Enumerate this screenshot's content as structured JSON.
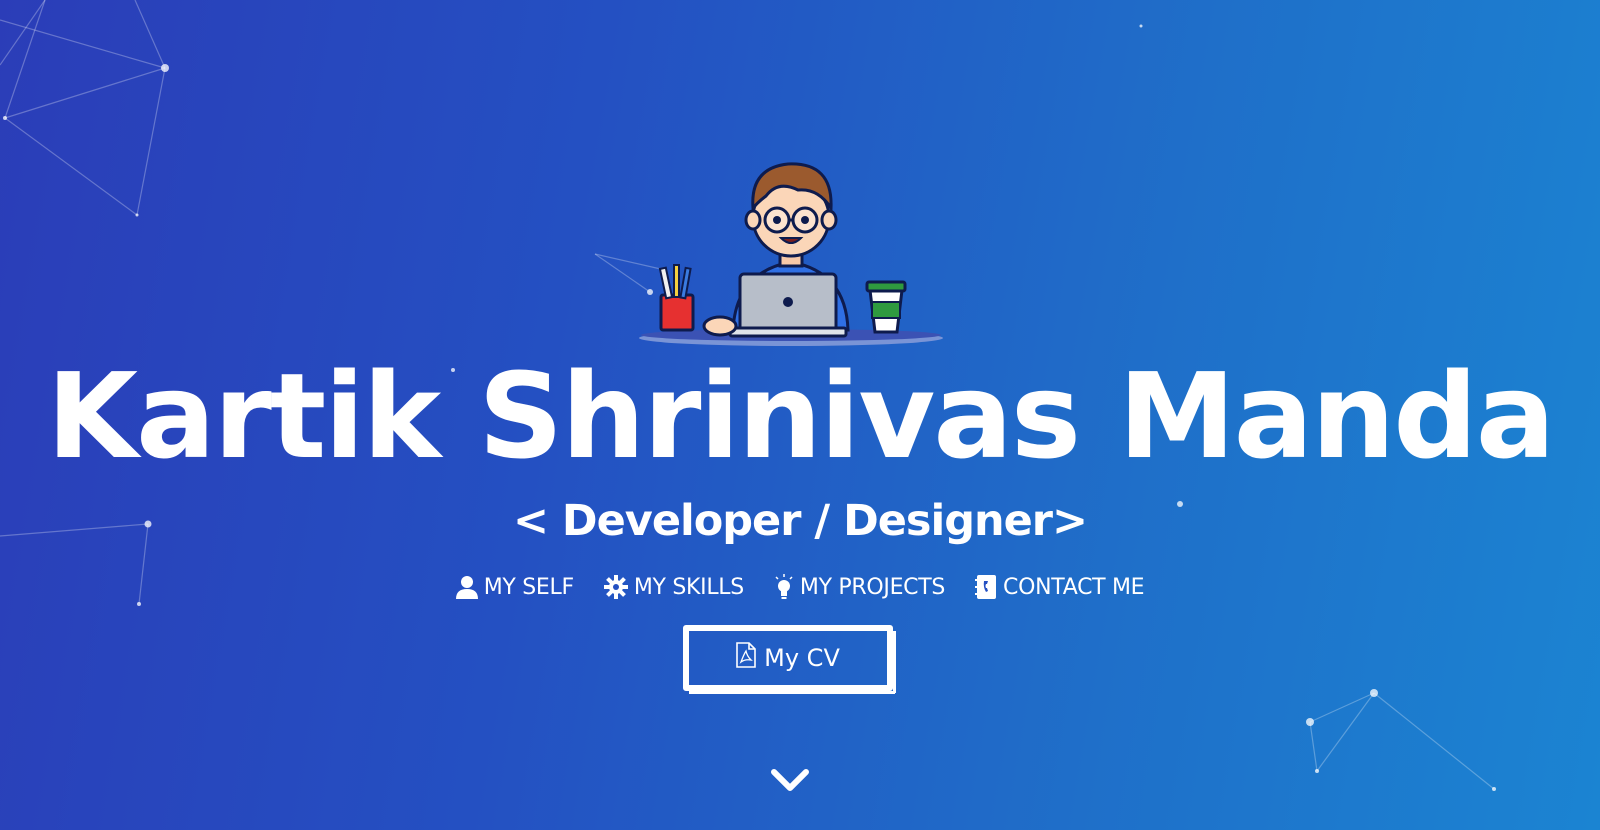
{
  "hero": {
    "name": "Kartik Shrinivas Manda",
    "role": "< Developer / Designer>"
  },
  "nav": {
    "items": [
      {
        "label": "MY SELF",
        "icon": "user-icon"
      },
      {
        "label": "MY SKILLS",
        "icon": "gear-icon"
      },
      {
        "label": "MY PROJECTS",
        "icon": "lightbulb-icon"
      },
      {
        "label": "CONTACT ME",
        "icon": "contact-book-icon"
      }
    ]
  },
  "cv_button": {
    "label": "My CV",
    "icon": "pdf-file-icon"
  },
  "scroll": {
    "icon": "chevron-down-icon"
  },
  "colors": {
    "gradient_start": "#2b3db8",
    "gradient_end": "#1b84d2",
    "text": "#ffffff"
  }
}
